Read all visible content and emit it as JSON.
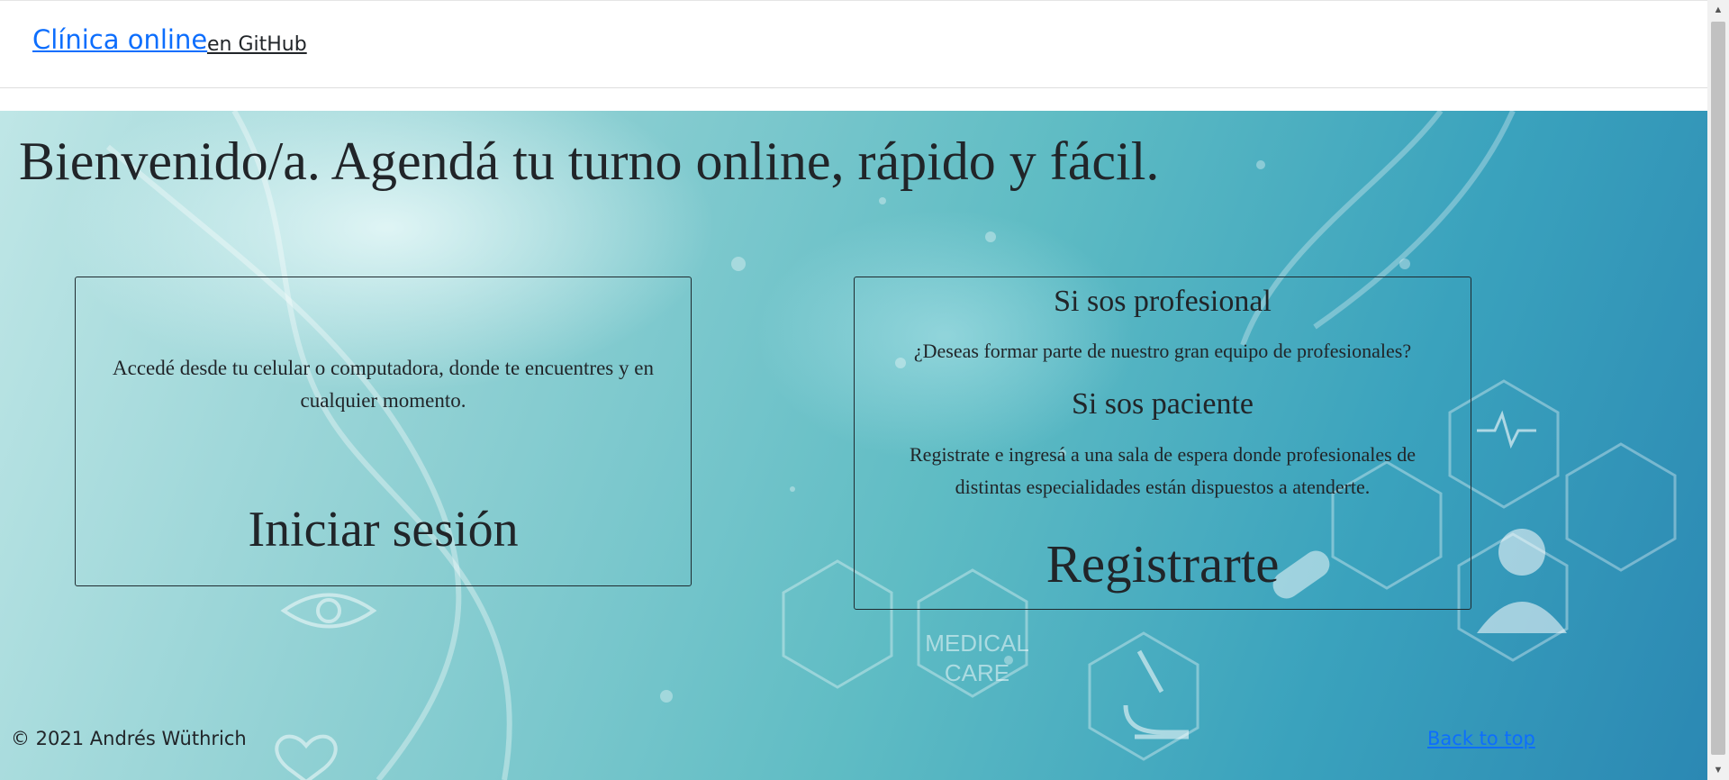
{
  "navbar": {
    "brand": "Clínica online",
    "github_link": "en GitHub"
  },
  "hero": {
    "title": "Bienvenido/a. Agendá tu turno online, rápido y fácil.",
    "background_image_text": "MEDICAL CARE"
  },
  "login_card": {
    "description": "Accedé desde tu celular o computadora, donde te encuentres y en cualquier momento.",
    "action_label": "Iniciar sesión"
  },
  "register_card": {
    "professional_heading": "Si sos profesional",
    "professional_text": "¿Deseas formar parte de nuestro gran equipo de profesionales?",
    "patient_heading": "Si sos paciente",
    "patient_text": "Registrate e ingresá a una sala de espera donde profesionales de distintas especialidades están dispuestos a atenderte.",
    "action_label": "Registrarte"
  },
  "footer": {
    "copyright": "© 2021 Andrés Wüthrich",
    "back_to_top": "Back to top"
  },
  "colors": {
    "link": "#0d6efd",
    "text": "#212529",
    "background_teal": "#5fbcc4"
  }
}
